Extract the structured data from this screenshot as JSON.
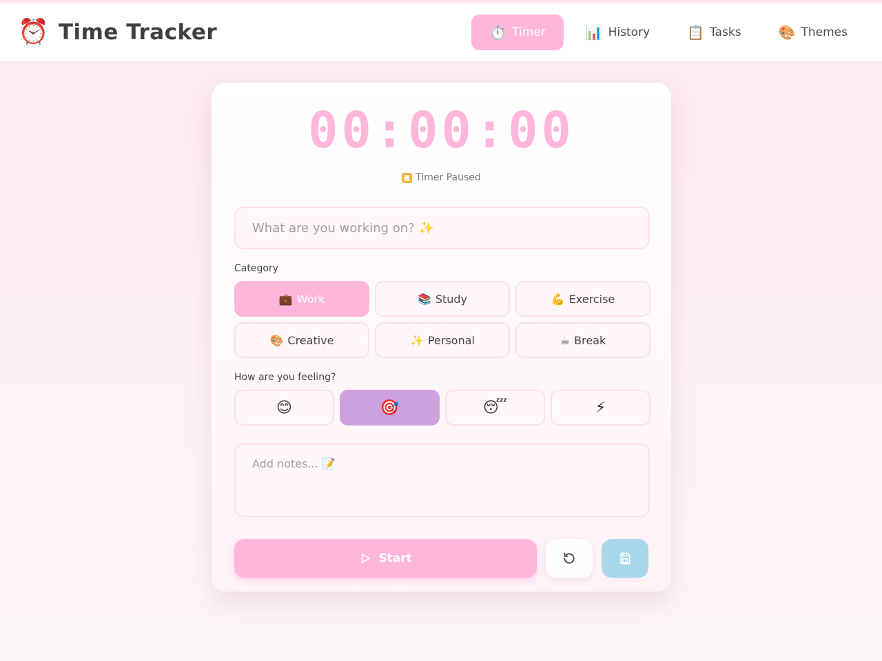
{
  "header": {
    "brand_icon": "⏰",
    "title": "Time Tracker",
    "nav": [
      {
        "icon": "⏱️",
        "label": "Timer",
        "active": true
      },
      {
        "icon": "📊",
        "label": "History",
        "active": false
      },
      {
        "icon": "📋",
        "label": "Tasks",
        "active": false
      },
      {
        "icon": "🎨",
        "label": "Themes",
        "active": false
      }
    ]
  },
  "timer": {
    "display": "00:00:00",
    "status_text": "Timer Paused"
  },
  "task_input": {
    "value": "",
    "placeholder": "What are you working on? ✨"
  },
  "category": {
    "label": "Category",
    "options": [
      {
        "icon": "💼",
        "label": "Work",
        "selected": true
      },
      {
        "icon": "📚",
        "label": "Study",
        "selected": false
      },
      {
        "icon": "💪",
        "label": "Exercise",
        "selected": false
      },
      {
        "icon": "🎨",
        "label": "Creative",
        "selected": false
      },
      {
        "icon": "✨",
        "label": "Personal",
        "selected": false
      },
      {
        "icon": "☕",
        "label": "Break",
        "selected": false
      }
    ]
  },
  "mood": {
    "label": "How are you feeling?",
    "options": [
      {
        "emoji": "😊",
        "selected": false
      },
      {
        "emoji": "🎯",
        "selected": true
      },
      {
        "emoji": "😴",
        "selected": false
      },
      {
        "emoji": "⚡",
        "selected": false
      }
    ]
  },
  "notes": {
    "value": "",
    "placeholder": "Add notes... 📝"
  },
  "actions": {
    "start_label": "Start"
  },
  "colors": {
    "accent_pink": "#ffb6db",
    "accent_purple": "#cda1dd",
    "accent_blue": "#a9d8ec"
  }
}
